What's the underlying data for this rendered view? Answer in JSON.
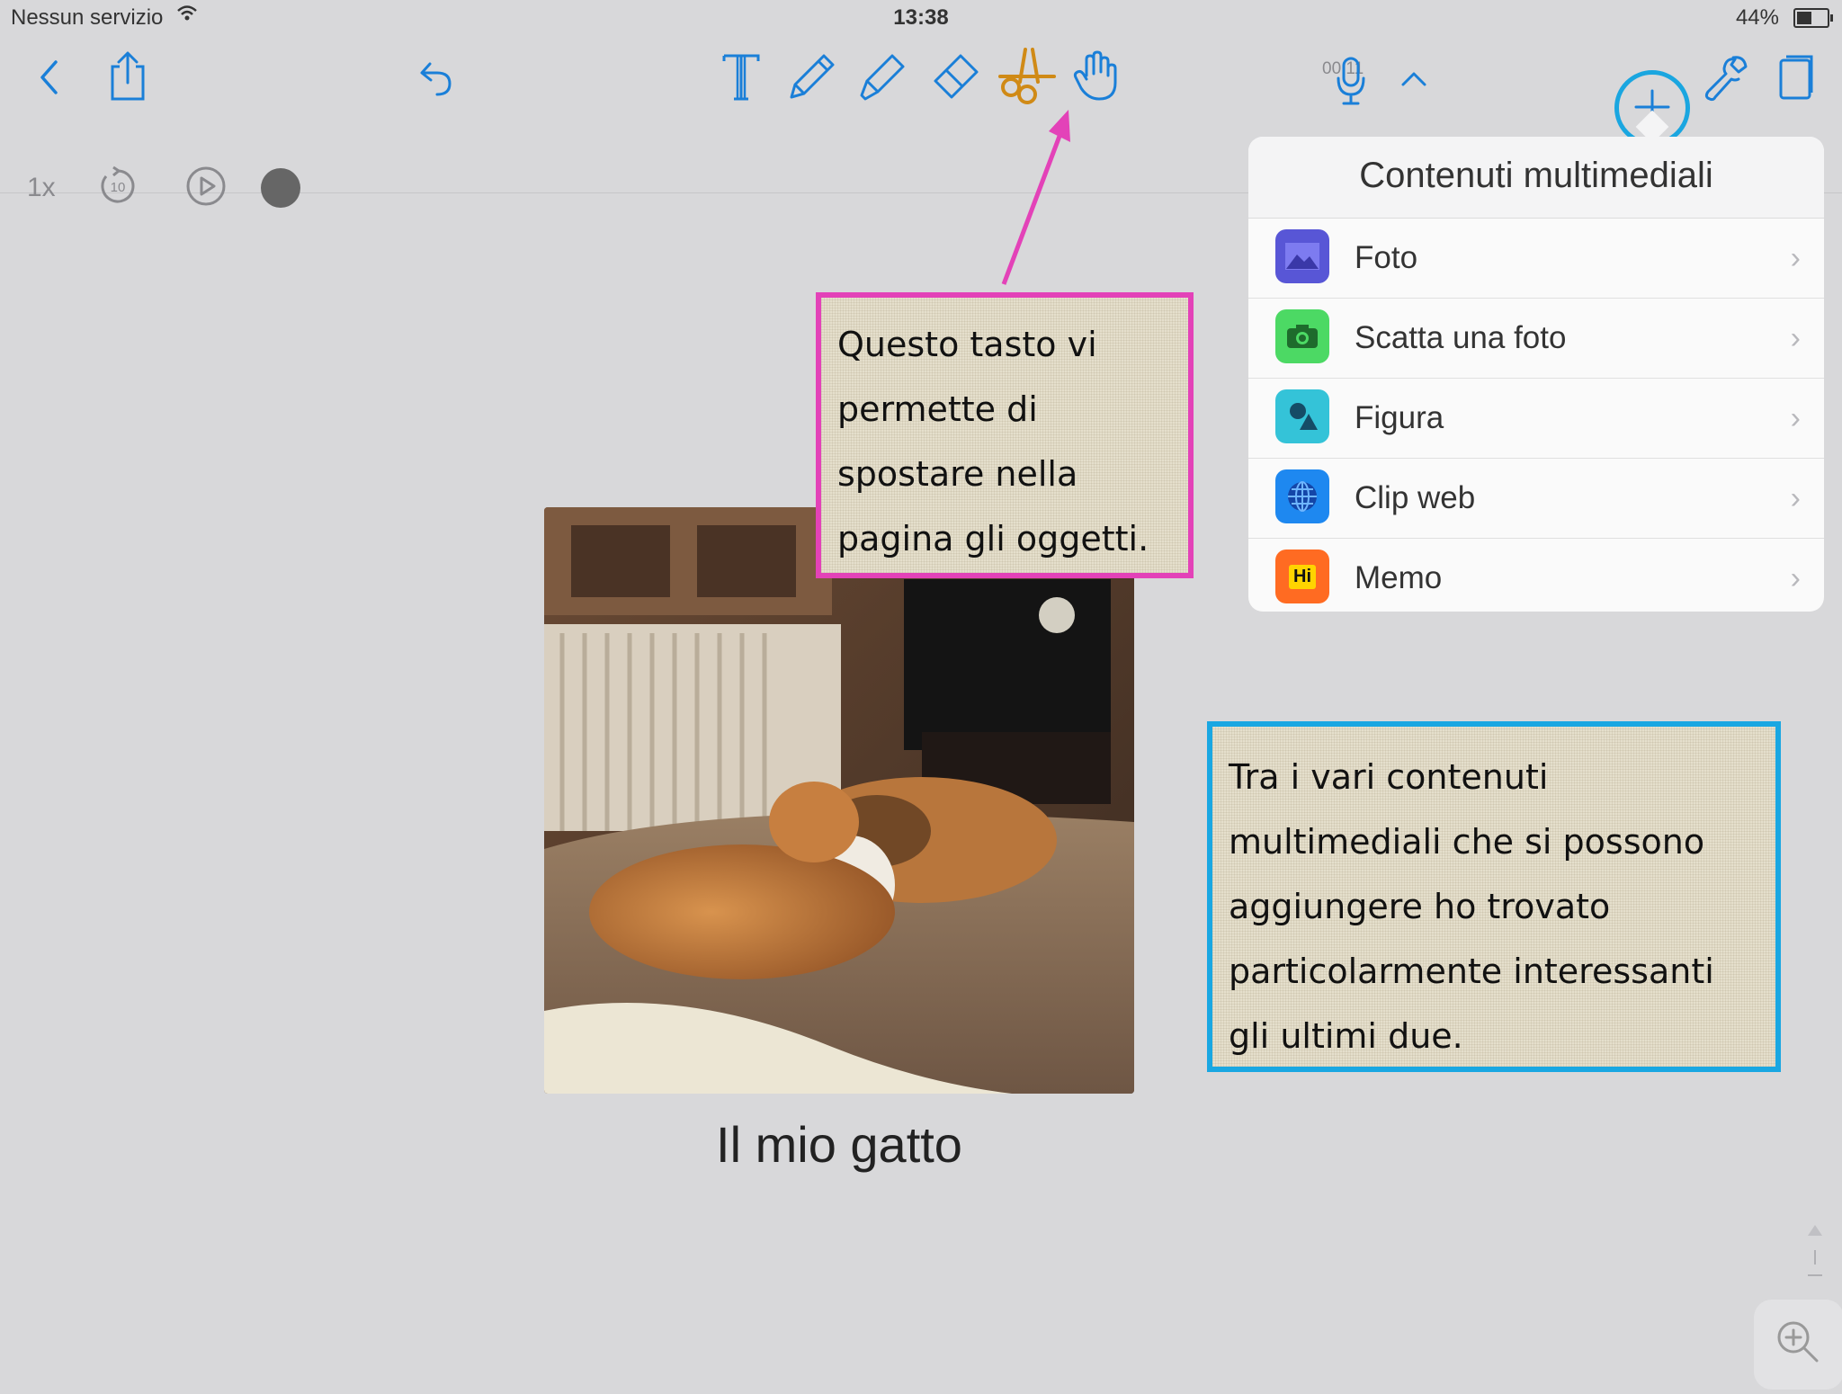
{
  "status_bar": {
    "carrier": "Nessun servizio",
    "time": "13:38",
    "battery_percent": "44%",
    "battery_level": 0.44
  },
  "toolbar": {
    "recording_time": "00:11",
    "playback_speed": "1x",
    "skip_back_seconds": "10",
    "icons": [
      "back-icon",
      "share-icon",
      "undo-icon",
      "text-tool-icon",
      "pen-icon",
      "highlighter-icon",
      "eraser-icon",
      "scissors-icon",
      "hand-icon",
      "microphone-icon",
      "chevron-up-icon",
      "add-icon",
      "wrench-icon",
      "pages-icon",
      "replay-10-icon",
      "play-icon",
      "record-icon"
    ],
    "accent_color": "#1a7fd8",
    "highlight_color": "#1aa6e0"
  },
  "popover": {
    "title": "Contenuti multimediali",
    "items": [
      {
        "label": "Foto",
        "icon": "photo-icon",
        "color": "#5856d6"
      },
      {
        "label": "Scatta una foto",
        "icon": "camera-icon",
        "color": "#4cd964"
      },
      {
        "label": "Figura",
        "icon": "shape-icon",
        "color": "#34c3d8"
      },
      {
        "label": "Clip web",
        "icon": "globe-icon",
        "color": "#1e88f0"
      },
      {
        "label": "Memo",
        "icon": "memo-icon",
        "color": "#ff6b22",
        "icon_text": "Hi"
      }
    ]
  },
  "annotations": {
    "pink_box": {
      "lines": [
        "Questo tasto vi",
        "permette di",
        "spostare nella",
        "pagina gli oggetti."
      ],
      "border_color": "#e342b8"
    },
    "blue_box": {
      "lines": [
        "Tra i vari contenuti",
        "multimediali che si possono",
        "aggiungere ho trovato",
        "particolarmente interessanti",
        "gli ultimi due."
      ],
      "border_color": "#19a7e2"
    },
    "arrow_color": "#e342b8"
  },
  "canvas": {
    "photo_caption": "Il mio gatto"
  }
}
